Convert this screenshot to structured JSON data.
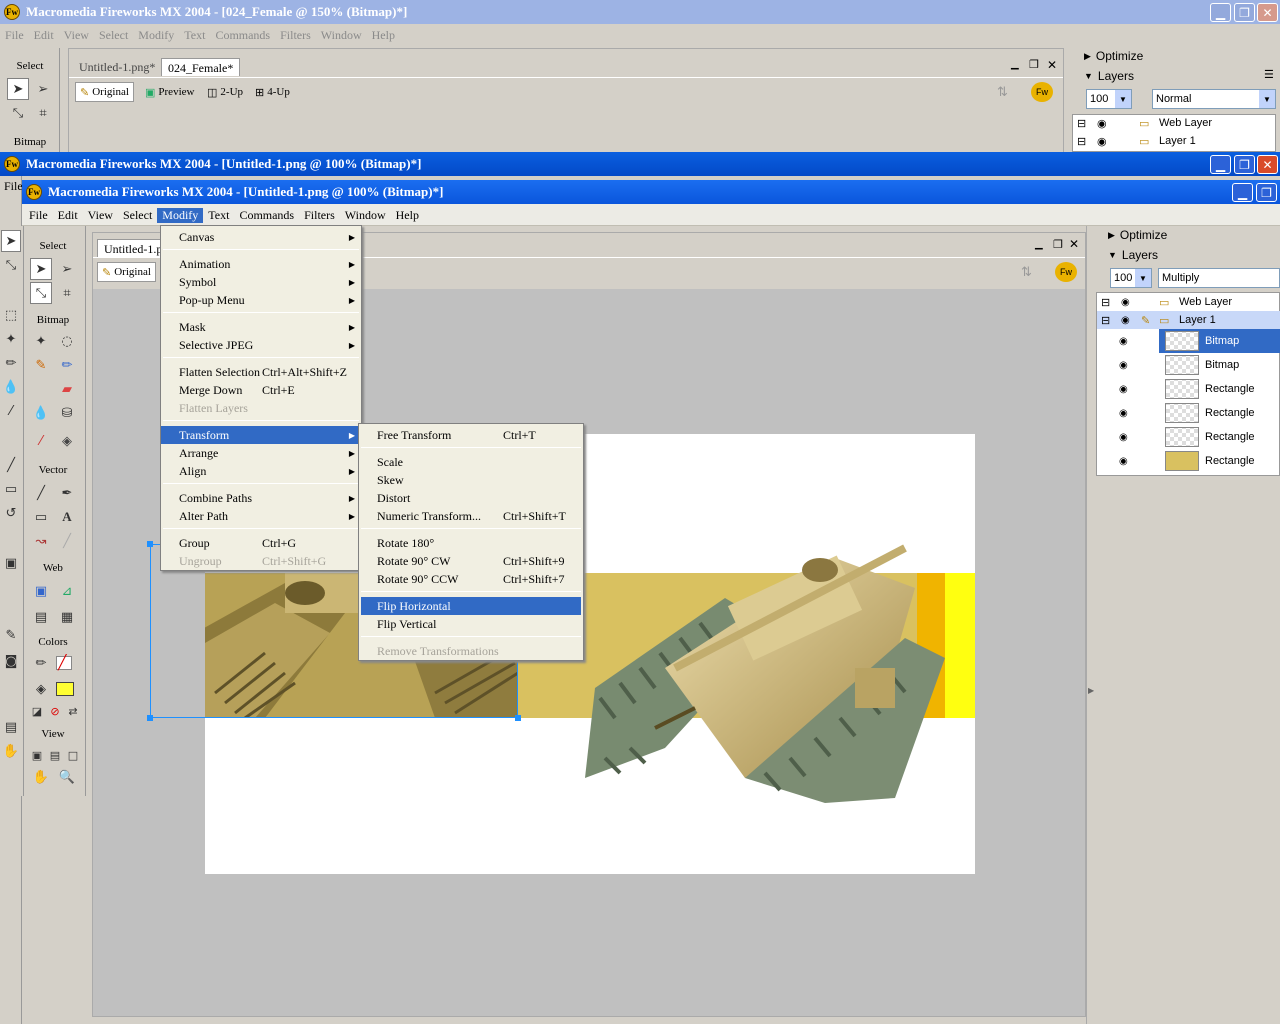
{
  "back_window": {
    "title": "Macromedia Fireworks MX 2004 - [024_Female @ 150% (Bitmap)*]",
    "menu": [
      "File",
      "Edit",
      "View",
      "Select",
      "Modify",
      "Text",
      "Commands",
      "Filters",
      "Window",
      "Help"
    ],
    "tabs": [
      "Untitled-1.png*",
      "024_Female*"
    ],
    "view_buttons": [
      "Original",
      "Preview",
      "2-Up",
      "4-Up"
    ],
    "tools_select_label": "Select",
    "tools_bitmap_label": "Bitmap",
    "optimize_label": "Optimize",
    "layers_label": "Layers",
    "opacity": "100",
    "blend_mode": "Normal",
    "layers": [
      "Web Layer",
      "Layer 1"
    ]
  },
  "mid_window": {
    "title": "Macromedia Fireworks MX 2004 - [Untitled-1.png @ 100% (Bitmap)*]",
    "menu_fragment": "File"
  },
  "front_window": {
    "title": "Macromedia Fireworks MX 2004 - [Untitled-1.png @ 100% (Bitmap)*]",
    "menu": [
      "File",
      "Edit",
      "View",
      "Select",
      "Modify",
      "Text",
      "Commands",
      "Filters",
      "Window",
      "Help"
    ],
    "active_menu": "Modify",
    "tab": "Untitled-1.p",
    "view_original": "Original"
  },
  "tools": {
    "select_label": "Select",
    "bitmap_label": "Bitmap",
    "vector_label": "Vector",
    "web_label": "Web",
    "colors_label": "Colors",
    "view_label": "View",
    "fill_color": "#ffff33",
    "stroke_color": "#222222"
  },
  "modify_menu": [
    {
      "label": "Canvas",
      "shortcut": "",
      "submenu": true,
      "disabled": false
    },
    {
      "label": "Animation",
      "shortcut": "",
      "submenu": true,
      "disabled": false
    },
    {
      "label": "Symbol",
      "shortcut": "",
      "submenu": true,
      "disabled": false
    },
    {
      "label": "Pop-up Menu",
      "shortcut": "",
      "submenu": true,
      "disabled": false
    },
    {
      "label": "Mask",
      "shortcut": "",
      "submenu": true,
      "disabled": false
    },
    {
      "label": "Selective JPEG",
      "shortcut": "",
      "submenu": true,
      "disabled": false
    },
    {
      "label": "Flatten Selection",
      "shortcut": "Ctrl+Alt+Shift+Z",
      "submenu": false,
      "disabled": false
    },
    {
      "label": "Merge Down",
      "shortcut": "Ctrl+E",
      "submenu": false,
      "disabled": false
    },
    {
      "label": "Flatten Layers",
      "shortcut": "",
      "submenu": false,
      "disabled": true
    },
    {
      "label": "Transform",
      "shortcut": "",
      "submenu": true,
      "disabled": false
    },
    {
      "label": "Arrange",
      "shortcut": "",
      "submenu": true,
      "disabled": false
    },
    {
      "label": "Align",
      "shortcut": "",
      "submenu": true,
      "disabled": false
    },
    {
      "label": "Combine Paths",
      "shortcut": "",
      "submenu": true,
      "disabled": false
    },
    {
      "label": "Alter Path",
      "shortcut": "",
      "submenu": true,
      "disabled": false
    },
    {
      "label": "Group",
      "shortcut": "Ctrl+G",
      "submenu": false,
      "disabled": false
    },
    {
      "label": "Ungroup",
      "shortcut": "Ctrl+Shift+G",
      "submenu": false,
      "disabled": true
    }
  ],
  "transform_menu": [
    {
      "label": "Free Transform",
      "shortcut": "Ctrl+T",
      "disabled": false
    },
    {
      "label": "Scale",
      "shortcut": "",
      "disabled": false
    },
    {
      "label": "Skew",
      "shortcut": "",
      "disabled": false
    },
    {
      "label": "Distort",
      "shortcut": "",
      "disabled": false
    },
    {
      "label": "Numeric Transform...",
      "shortcut": "Ctrl+Shift+T",
      "disabled": false
    },
    {
      "label": "Rotate 180°",
      "shortcut": "",
      "disabled": false
    },
    {
      "label": "Rotate 90° CW",
      "shortcut": "Ctrl+Shift+9",
      "disabled": false
    },
    {
      "label": "Rotate 90° CCW",
      "shortcut": "Ctrl+Shift+7",
      "disabled": false
    },
    {
      "label": "Flip Horizontal",
      "shortcut": "",
      "disabled": false
    },
    {
      "label": "Flip Vertical",
      "shortcut": "",
      "disabled": false
    },
    {
      "label": "Remove Transformations",
      "shortcut": "",
      "disabled": true
    }
  ],
  "right_panel": {
    "optimize_label": "Optimize",
    "layers_label": "Layers",
    "opacity": "100",
    "blend_mode": "Multiply",
    "web_layer": "Web Layer",
    "layer1": "Layer 1",
    "objects": [
      "Bitmap",
      "Bitmap",
      "Rectangle",
      "Rectangle",
      "Rectangle",
      "Rectangle"
    ]
  }
}
